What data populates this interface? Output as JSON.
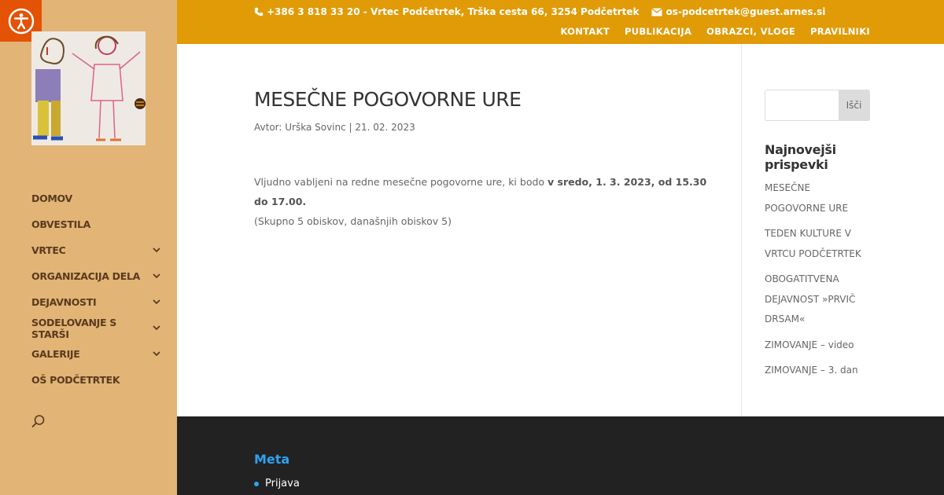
{
  "colors": {
    "sidebar_bg": "#e2b476",
    "topbar_bg": "#e09b07",
    "accessibility_btn": "#e35205",
    "footer_bg": "#222222",
    "link_blue": "#2ea3f2"
  },
  "topbar": {
    "phone_icon": "phone-icon",
    "contact_text": "+386 3 818 33 20 - Vrtec Podčetrtek, Trška cesta 66, 3254 Podčetrtek",
    "email_icon": "envelope-icon",
    "email": "os-podcetrtek@guest.arnes.si",
    "nav": [
      "KONTAKT",
      "PUBLIKACIJA",
      "OBRAZCI, VLOGE",
      "PRAVILNIKI"
    ]
  },
  "sidebar": {
    "accessibility_icon": "accessibility-icon",
    "logo_alt": "children-drawing-logo",
    "nav": [
      {
        "label": "DOMOV",
        "has_children": false
      },
      {
        "label": "OBVESTILA",
        "has_children": false
      },
      {
        "label": "VRTEC",
        "has_children": true
      },
      {
        "label": "ORGANIZACIJA DELA",
        "has_children": true
      },
      {
        "label": "DEJAVNOSTI",
        "has_children": true
      },
      {
        "label": "SODELOVANJE S STARŠI",
        "has_children": true
      },
      {
        "label": "GALERIJE",
        "has_children": true
      },
      {
        "label": "OŠ PODČETRTEK",
        "has_children": false
      }
    ],
    "search_placeholder": ""
  },
  "post": {
    "title": "MESEČNE POGOVORNE URE",
    "meta": "Avtor: Urška Sovinc | 21. 02. 2023",
    "body_intro": "Vljudno vabljeni na redne mesečne pogovorne ure, ki bodo ",
    "body_bold": "v sredo, 1. 3. 2023, od 15.30 do 17.00.",
    "visits": "(Skupno 5 obiskov, današnjih obiskov 5)"
  },
  "right_sidebar": {
    "search_value": "",
    "search_button": "Išči",
    "recent_title": "Najnovejši prispevki",
    "recent_posts": [
      "MESEČNE POGOVORNE URE",
      "TEDEN KULTURE V VRTCU PODČETRTEK",
      "OBOGATITVENA DEJAVNOST »PRVIČ DRSAM«",
      "ZIMOVANJE – video",
      "ZIMOVANJE – 3. dan"
    ]
  },
  "footer": {
    "meta_title": "Meta",
    "meta_links": [
      "Prijava"
    ]
  }
}
